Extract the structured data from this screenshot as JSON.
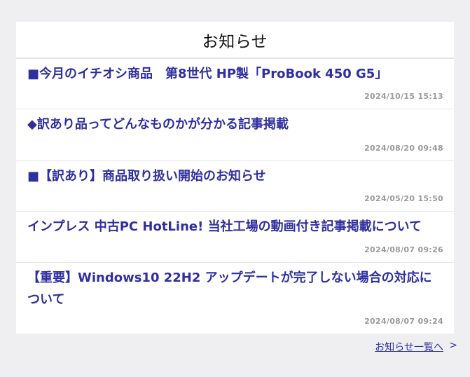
{
  "news": {
    "heading": "お知らせ",
    "items": [
      {
        "title": "■今月のイチオシ商品　第8世代 HP製「ProBook 450 G5」",
        "date": "2024/10/15 15:13"
      },
      {
        "title": "◆訳あり品ってどんなものかが分かる記事掲載",
        "date": "2024/08/20 09:48"
      },
      {
        "title": "■【訳あり】商品取り扱い開始のお知らせ",
        "date": "2024/05/20 15:50"
      },
      {
        "title": "インプレス 中古PC HotLine! 当社工場の動画付き記事掲載について",
        "date": "2024/08/07 09:26"
      },
      {
        "title": "【重要】Windows10 22H2 アップデートが完了しない場合の対応について",
        "date": "2024/08/07 09:24"
      }
    ],
    "more_label": "お知らせ一覧へ",
    "more_arrow": ">"
  }
}
